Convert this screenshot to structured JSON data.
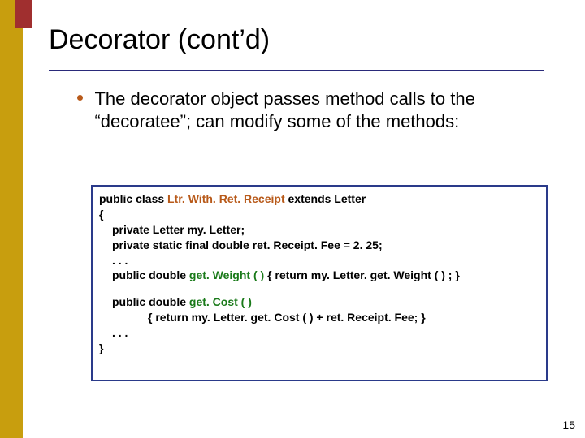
{
  "title": "Decorator (cont’d)",
  "bullet": "The decorator object passes method calls to the “decoratee”; can modify some of the methods:",
  "code": {
    "l1a": "public class ",
    "l1b": "Ltr. With. Ret. Receipt",
    "l1c": "  extends Letter",
    "l2": "{",
    "l3": "private Letter my. Letter;",
    "l4": "private static final double ret. Receipt. Fee = 2. 25;",
    "l5": ". . .",
    "l6a": "public double ",
    "l6b": "get. Weight ( )",
    "l6c": "   { return my. Letter. get. Weight ( ) ; }",
    "l7a": "public double ",
    "l7b": "get. Cost ( )",
    "l8": "{ return my. Letter. get. Cost ( ) + ret. Receipt. Fee; }",
    "l9": ". . .",
    "l10": "}"
  },
  "page_number": "15"
}
